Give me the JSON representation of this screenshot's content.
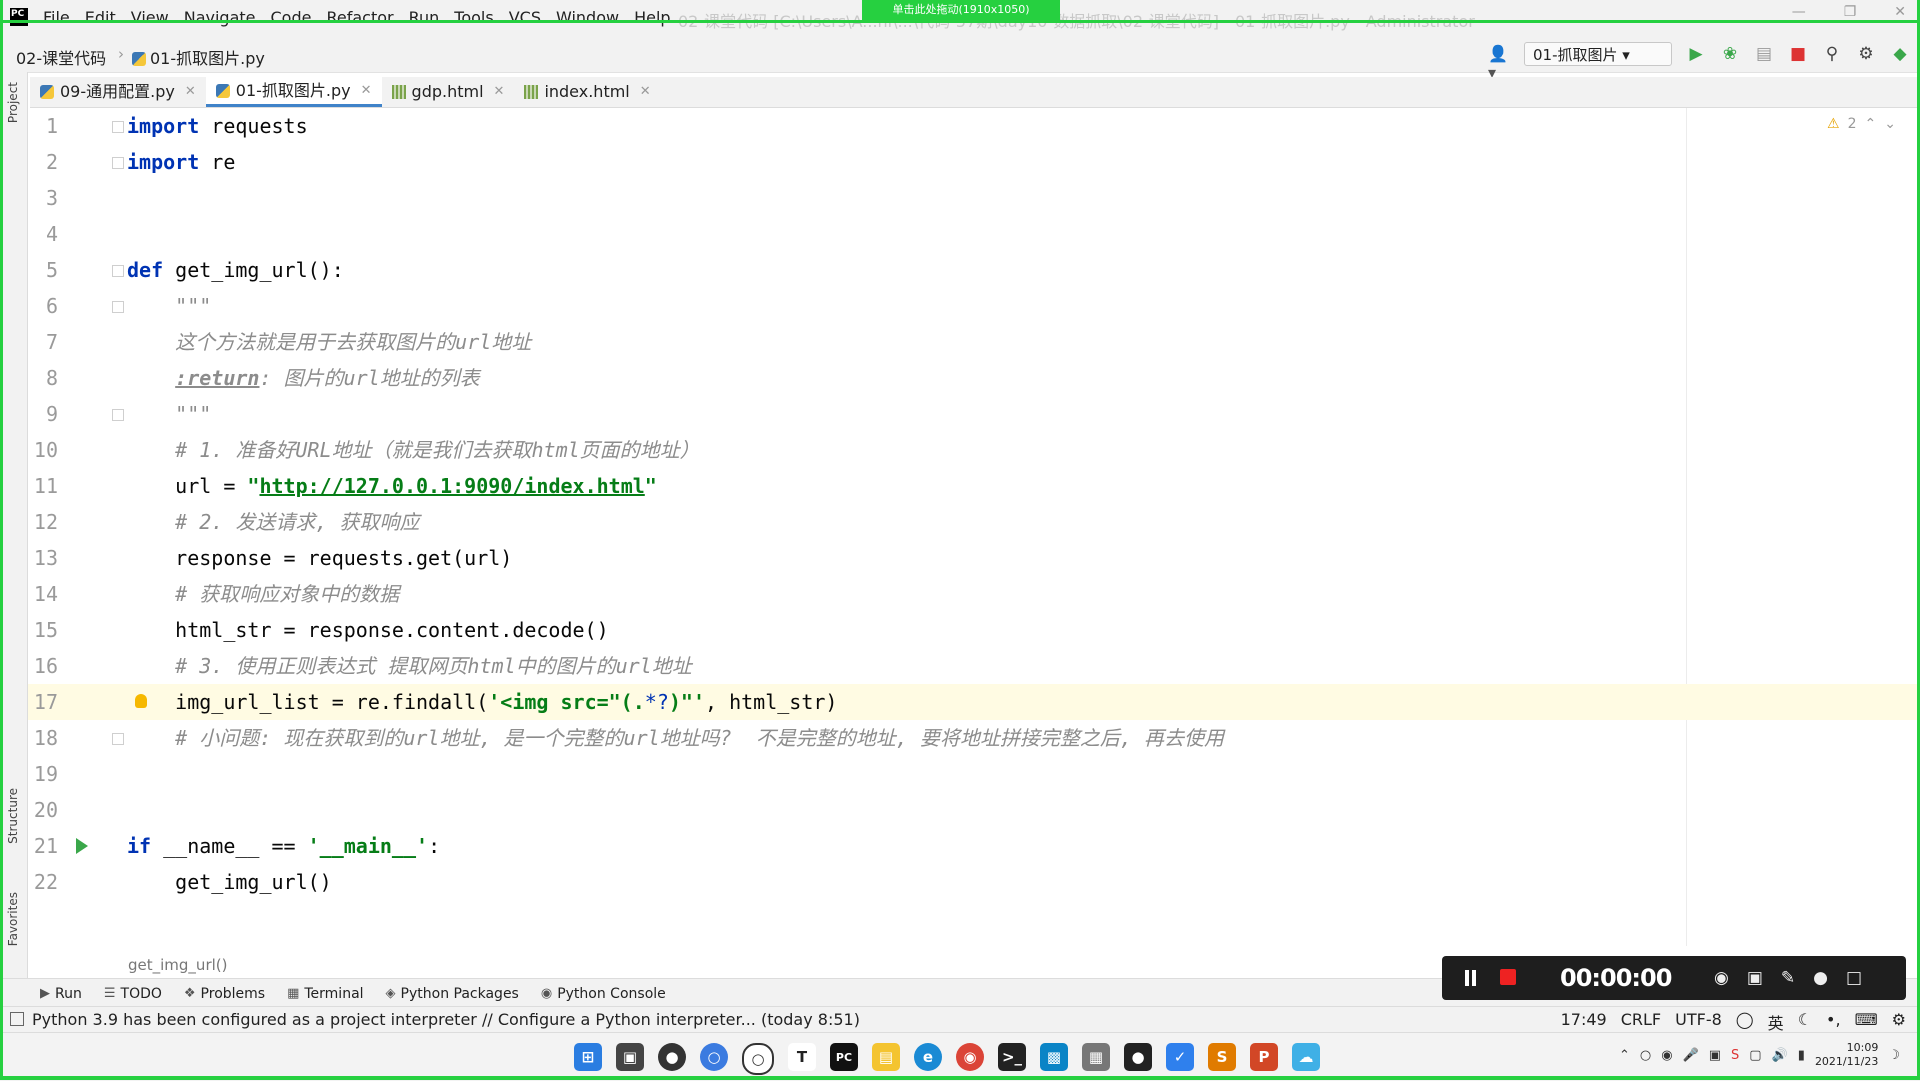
{
  "recording": {
    "drag_hint": "单击此处拖动(1910x1050)",
    "timer": "00:00:00"
  },
  "menu": {
    "items": [
      "File",
      "Edit",
      "View",
      "Navigate",
      "Code",
      "Refactor",
      "Run",
      "Tools",
      "VCS",
      "Window",
      "Help"
    ],
    "window_title": "02-课堂代码 [C:\\Users\\A...ni\\...\\代码-57期\\day10-数据抓取\\02-课堂代码] - 01-抓取图片.py - Administrator"
  },
  "nav": {
    "project": "02-课堂代码",
    "file": "01-抓取图片.py",
    "run_config": "01-抓取图片"
  },
  "tabs": [
    {
      "label": "09-通用配置.py",
      "type": "py",
      "active": false
    },
    {
      "label": "01-抓取图片.py",
      "type": "py",
      "active": true
    },
    {
      "label": "gdp.html",
      "type": "html",
      "active": false
    },
    {
      "label": "index.html",
      "type": "html",
      "active": false
    }
  ],
  "side_panels": {
    "project": "Project",
    "structure": "Structure",
    "favorites": "Favorites"
  },
  "editor": {
    "warning_count": "2",
    "current_line": 17,
    "lines": [
      "import requests",
      "import re",
      "",
      "",
      "def get_img_url():",
      "    \"\"\"",
      "    这个方法就是用于去获取图片的url地址",
      "    :return: 图片的url地址的列表",
      "    \"\"\"",
      "    # 1. 准备好URL地址（就是我们去获取html页面的地址）",
      "    url = \"http://127.0.0.1:9090/index.html\"",
      "    # 2. 发送请求, 获取响应",
      "    response = requests.get(url)",
      "    # 获取响应对象中的数据",
      "    html_str = response.content.decode()",
      "    # 3. 使用正则表达式 提取网页html中的图片的url地址",
      "    img_url_list = re.findall('<img src=\"(.*?)\"', html_str)",
      "    # 小问题: 现在获取到的url地址, 是一个完整的url地址吗?  不是完整的地址, 要将地址拼接完整之后, 再去使用",
      "",
      "",
      "if __name__ == '__main__':",
      "    get_img_url()"
    ],
    "breadcrumb": "get_img_url()"
  },
  "bottom_tools": [
    "Run",
    "TODO",
    "Problems",
    "Terminal",
    "Python Packages",
    "Python Console"
  ],
  "status": {
    "message": "Python 3.9 has been configured as a project interpreter // Configure a Python interpreter... (today 8:51)",
    "position": "17:49",
    "line_sep": "CRLF",
    "encoding": "UTF-8"
  },
  "ime": {
    "lang": "英"
  },
  "clock": {
    "time": "10:09",
    "date": "2021/11/23"
  },
  "colors": {
    "keyword": "#0033b3",
    "string": "#067d17",
    "comment": "#8c8c8c",
    "frame": "#26d040"
  }
}
